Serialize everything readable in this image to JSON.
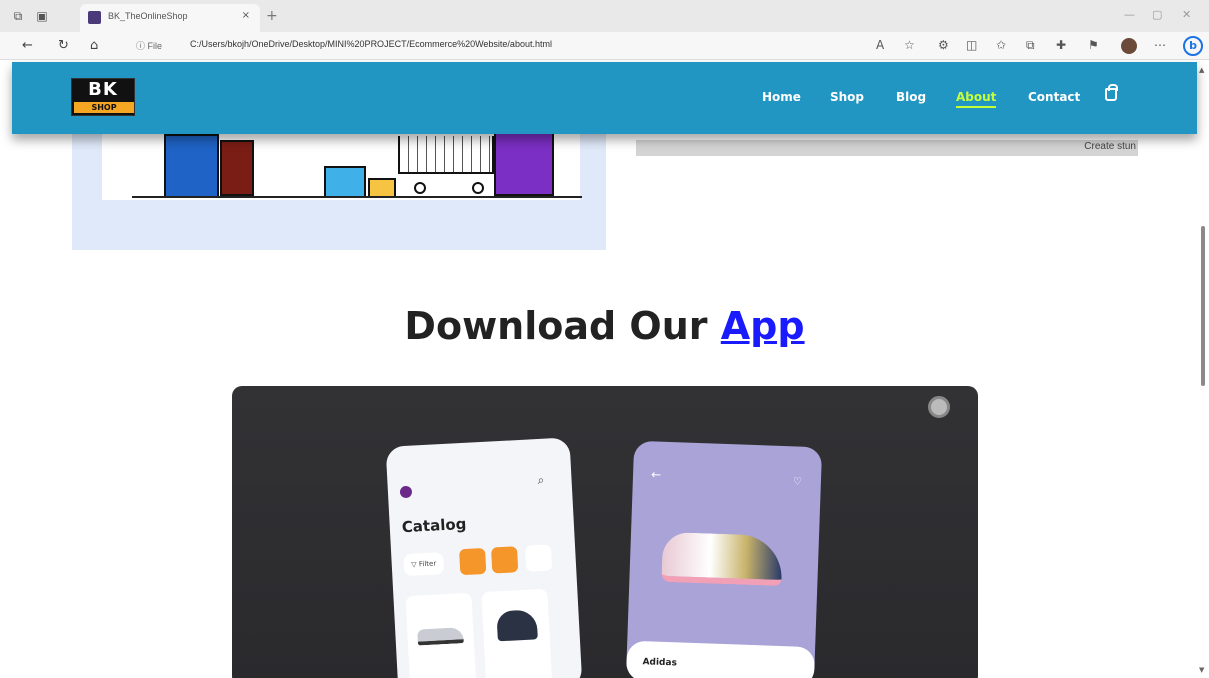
{
  "browser": {
    "tab_title": "BK_TheOnlineShop",
    "tab_close": "×",
    "new_tab": "+",
    "url_label": "ⓘ File",
    "url": "C:/Users/bkojh/OneDrive/Desktop/MINI%20PROJECT/Ecommerce%20Website/about.html",
    "win_min": "—",
    "win_max": "▢",
    "win_close": "✕",
    "back_icon": "←",
    "refresh_icon": "↻",
    "home_icon": "⌂",
    "bing_label": "b"
  },
  "header": {
    "logo_top": "BK",
    "logo_bottom": "SHOP",
    "nav": [
      "Home",
      "Shop",
      "Blog",
      "About",
      "Contact"
    ],
    "active": "About"
  },
  "about": {
    "gray_text": "Create stun"
  },
  "download": {
    "title_prefix": "Download Our",
    "title_link": "App"
  },
  "app_mockup": {
    "catalog_title": "Catalog",
    "filter_label": "▽ Filter",
    "product_name": "Adidas"
  },
  "colors": {
    "header_bg": "#2196c3",
    "active_nav": "#c6ff3a",
    "link": "#1a1aff",
    "video_bg": "#2f2f32"
  }
}
